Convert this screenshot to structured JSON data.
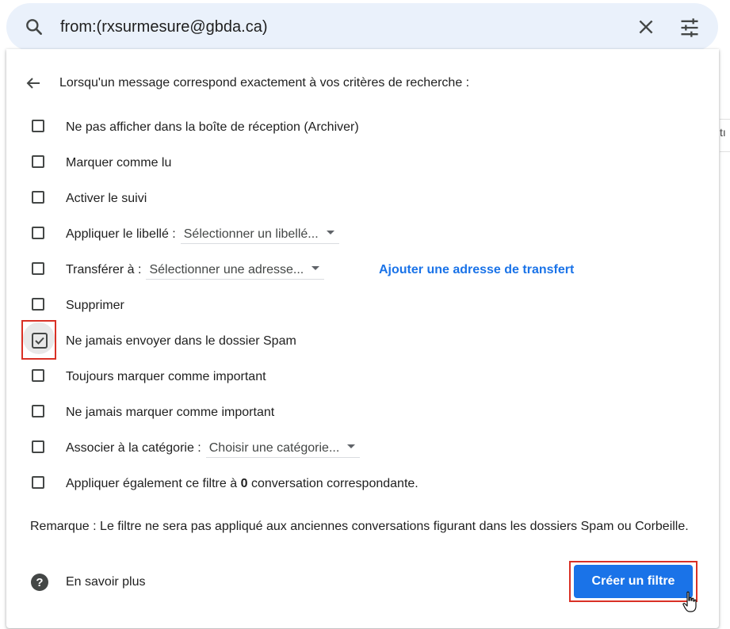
{
  "search": {
    "query": "from:(rxsurmesure@gbda.ca)"
  },
  "edge_fragment_text": "tı",
  "panel": {
    "header": "Lorsqu'un message correspond exactement à vos critères de recherche :",
    "options": [
      {
        "label": "Ne pas afficher dans la boîte de réception (Archiver)",
        "checked": false
      },
      {
        "label": "Marquer comme lu",
        "checked": false
      },
      {
        "label": "Activer le suivi",
        "checked": false
      },
      {
        "label": "Appliquer le libellé :",
        "select": "Sélectionner un libellé...",
        "checked": false
      },
      {
        "label": "Transférer à :",
        "select": "Sélectionner une adresse...",
        "link": "Ajouter une adresse de transfert",
        "checked": false
      },
      {
        "label": "Supprimer",
        "checked": false
      },
      {
        "label": "Ne jamais envoyer dans le dossier Spam",
        "checked": true
      },
      {
        "label": "Toujours marquer comme important",
        "checked": false
      },
      {
        "label": "Ne jamais marquer comme important",
        "checked": false
      },
      {
        "label": "Associer à la catégorie :",
        "select": "Choisir une catégorie...",
        "checked": false
      },
      {
        "label_before": "Appliquer également ce filtre à",
        "count": "0",
        "label_after": "conversation correspondante.",
        "checked": false
      }
    ],
    "note": "Remarque : Le filtre ne sera pas appliqué aux anciennes conversations figurant dans les dossiers Spam ou Corbeille.",
    "help_label": "En savoir plus",
    "create_button": "Créer un filtre"
  },
  "colors": {
    "accent": "#1a73e8",
    "highlight": "#d93025",
    "searchbar_bg": "#eaf1fb"
  },
  "icons": [
    "search-icon",
    "close-icon",
    "tune-icon",
    "back-arrow-icon",
    "checkbox-icon",
    "checked-checkbox-icon",
    "dropdown-caret-icon",
    "help-icon",
    "hand-cursor-icon"
  ]
}
